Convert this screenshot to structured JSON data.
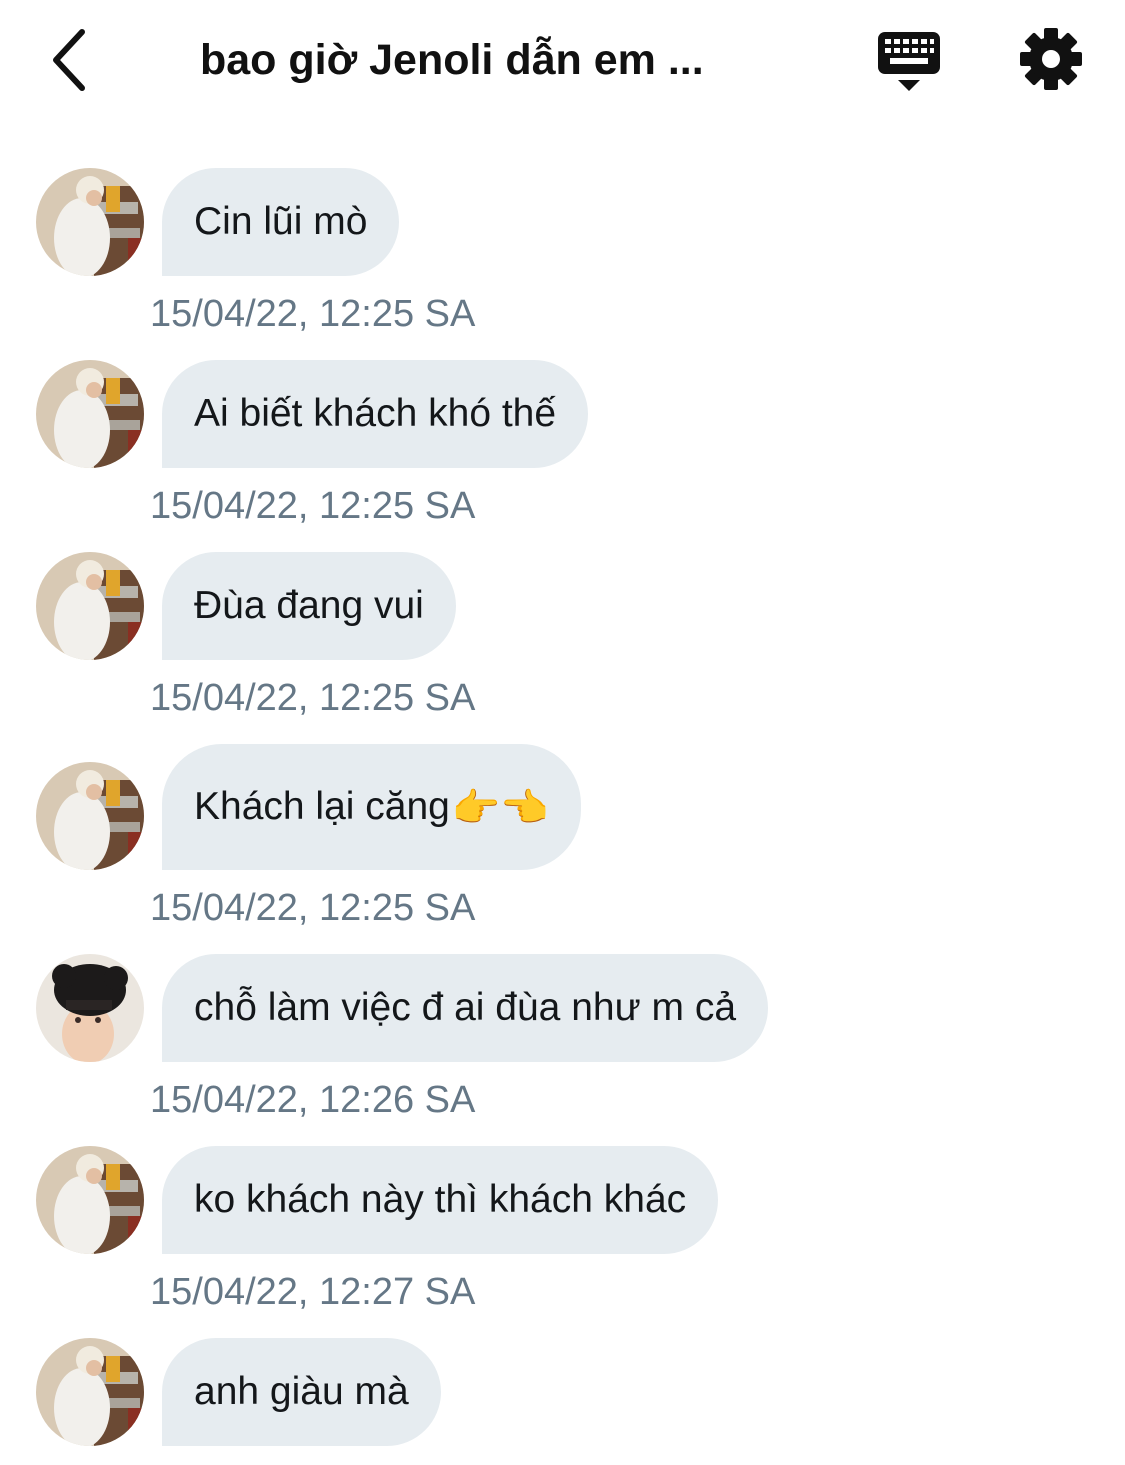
{
  "header": {
    "back_icon": "chevron-left-icon",
    "title": "bao giờ Jenoli dẫn em ...",
    "keyboard_icon": "keyboard-icon",
    "settings_icon": "gear-icon"
  },
  "messages": [
    {
      "sender": "a",
      "text": "Cin lũi mò",
      "time": "15/04/22, 12:25 SA"
    },
    {
      "sender": "a",
      "text": "Ai biết khách khó thế",
      "time": "15/04/22, 12:25 SA"
    },
    {
      "sender": "a",
      "text": "Đùa đang vui",
      "time": "15/04/22, 12:25 SA"
    },
    {
      "sender": "a",
      "text": "Khách lại căng",
      "emoji": "👉👈",
      "time": "15/04/22, 12:25 SA"
    },
    {
      "sender": "b",
      "text": "chỗ làm việc đ ai đùa như m cả",
      "time": "15/04/22, 12:26 SA"
    },
    {
      "sender": "a",
      "text": "ko khách này thì khách khác",
      "time": "15/04/22, 12:27 SA"
    },
    {
      "sender": "a",
      "text": "anh giàu mà",
      "time": ""
    }
  ],
  "colors": {
    "bubble": "#e6ecf0",
    "timestamp": "#657786",
    "text": "#14171a"
  }
}
